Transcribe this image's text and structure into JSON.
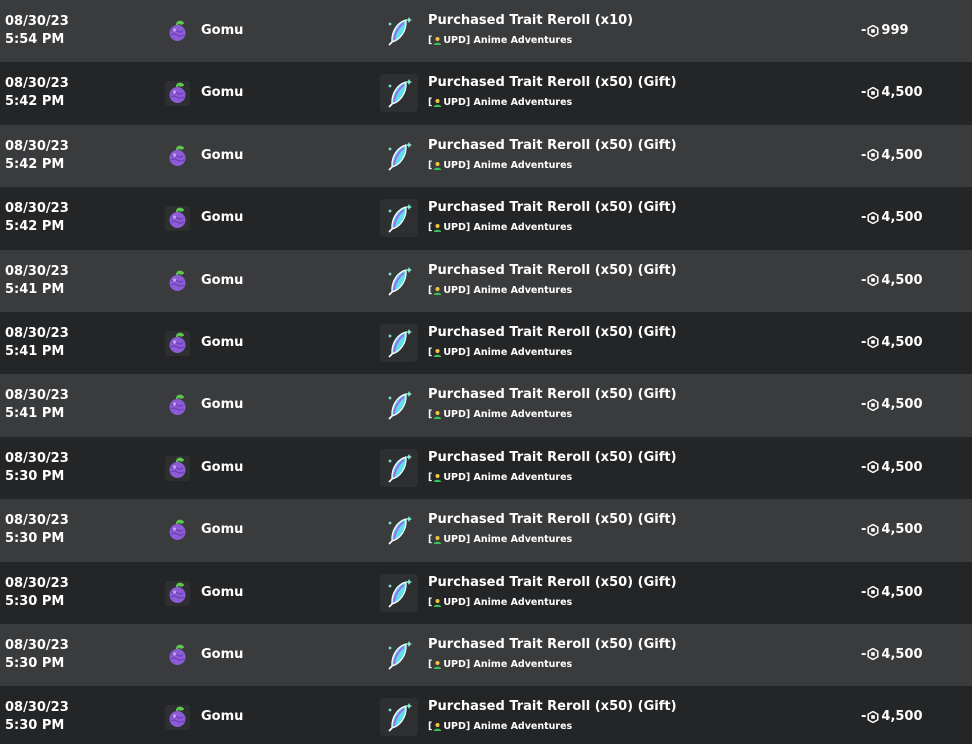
{
  "transactions": [
    {
      "date": "08/30/23",
      "time": "5:54 PM",
      "user": "Gomu",
      "item": "Purchased Trait Reroll (x10)",
      "game_prefix": "[",
      "game": "UPD] Anime Adventures",
      "sign": "-",
      "amount": "999"
    },
    {
      "date": "08/30/23",
      "time": "5:42 PM",
      "user": "Gomu",
      "item": "Purchased Trait Reroll (x50) (Gift)",
      "game_prefix": "[",
      "game": "UPD] Anime Adventures",
      "sign": "-",
      "amount": "4,500"
    },
    {
      "date": "08/30/23",
      "time": "5:42 PM",
      "user": "Gomu",
      "item": "Purchased Trait Reroll (x50) (Gift)",
      "game_prefix": "[",
      "game": "UPD] Anime Adventures",
      "sign": "-",
      "amount": "4,500"
    },
    {
      "date": "08/30/23",
      "time": "5:42 PM",
      "user": "Gomu",
      "item": "Purchased Trait Reroll (x50) (Gift)",
      "game_prefix": "[",
      "game": "UPD] Anime Adventures",
      "sign": "-",
      "amount": "4,500"
    },
    {
      "date": "08/30/23",
      "time": "5:41 PM",
      "user": "Gomu",
      "item": "Purchased Trait Reroll (x50) (Gift)",
      "game_prefix": "[",
      "game": "UPD] Anime Adventures",
      "sign": "-",
      "amount": "4,500"
    },
    {
      "date": "08/30/23",
      "time": "5:41 PM",
      "user": "Gomu",
      "item": "Purchased Trait Reroll (x50) (Gift)",
      "game_prefix": "[",
      "game": "UPD] Anime Adventures",
      "sign": "-",
      "amount": "4,500"
    },
    {
      "date": "08/30/23",
      "time": "5:41 PM",
      "user": "Gomu",
      "item": "Purchased Trait Reroll (x50) (Gift)",
      "game_prefix": "[",
      "game": "UPD] Anime Adventures",
      "sign": "-",
      "amount": "4,500"
    },
    {
      "date": "08/30/23",
      "time": "5:30 PM",
      "user": "Gomu",
      "item": "Purchased Trait Reroll (x50) (Gift)",
      "game_prefix": "[",
      "game": "UPD] Anime Adventures",
      "sign": "-",
      "amount": "4,500"
    },
    {
      "date": "08/30/23",
      "time": "5:30 PM",
      "user": "Gomu",
      "item": "Purchased Trait Reroll (x50) (Gift)",
      "game_prefix": "[",
      "game": "UPD] Anime Adventures",
      "sign": "-",
      "amount": "4,500"
    },
    {
      "date": "08/30/23",
      "time": "5:30 PM",
      "user": "Gomu",
      "item": "Purchased Trait Reroll (x50) (Gift)",
      "game_prefix": "[",
      "game": "UPD] Anime Adventures",
      "sign": "-",
      "amount": "4,500"
    },
    {
      "date": "08/30/23",
      "time": "5:30 PM",
      "user": "Gomu",
      "item": "Purchased Trait Reroll (x50) (Gift)",
      "game_prefix": "[",
      "game": "UPD] Anime Adventures",
      "sign": "-",
      "amount": "4,500"
    },
    {
      "date": "08/30/23",
      "time": "5:30 PM",
      "user": "Gomu",
      "item": "Purchased Trait Reroll (x50) (Gift)",
      "game_prefix": "[",
      "game": "UPD] Anime Adventures",
      "sign": "-",
      "amount": "4,500"
    }
  ],
  "icons": {
    "avatar": "devil-fruit-icon",
    "item": "crystal-feather-icon",
    "game_badge": "user-badge-icon",
    "currency": "robux-icon"
  },
  "colors": {
    "row_light": "#393b3d",
    "row_dark": "#232527",
    "text": "#ffffff",
    "fruit": "#8e5bd6",
    "crystal": "#5de0e6"
  }
}
